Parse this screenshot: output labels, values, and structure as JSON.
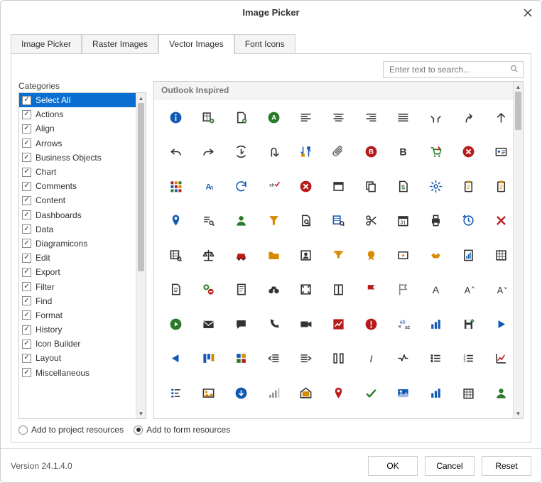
{
  "window": {
    "title": "Image Picker"
  },
  "tabs": [
    {
      "label": "Image Picker"
    },
    {
      "label": "Raster Images"
    },
    {
      "label": "Vector Images"
    },
    {
      "label": "Font Icons"
    }
  ],
  "active_tab": 2,
  "search": {
    "placeholder": "Enter text to search..."
  },
  "categories_label": "Categories",
  "categories": [
    "Select All",
    "Actions",
    "Align",
    "Arrows",
    "Business Objects",
    "Chart",
    "Comments",
    "Content",
    "Dashboards",
    "Data",
    "Diagramicons",
    "Edit",
    "Export",
    "Filter",
    "Find",
    "Format",
    "History",
    "Icon Builder",
    "Layout",
    "Miscellaneous"
  ],
  "selected_category_index": 0,
  "group_header": "Outlook Inspired",
  "icons": [
    {
      "n": "info-icon",
      "c": "#1259b3",
      "t": "circle-i"
    },
    {
      "n": "add-column-icon",
      "c": "#2a7a2a",
      "t": "table-plus"
    },
    {
      "n": "add-page-icon",
      "c": "#333",
      "t": "page-plus"
    },
    {
      "n": "letter-a-circle-icon",
      "c": "#2a7a2a",
      "t": "circle-a"
    },
    {
      "n": "align-left-icon",
      "c": "#333",
      "t": "align-left"
    },
    {
      "n": "align-center-icon",
      "c": "#333",
      "t": "align-center"
    },
    {
      "n": "align-right-icon",
      "c": "#333",
      "t": "align-right"
    },
    {
      "n": "align-justify-icon",
      "c": "#333",
      "t": "align-justify"
    },
    {
      "n": "merge-arrows-icon",
      "c": "#333",
      "t": "merge"
    },
    {
      "n": "redo-up-icon",
      "c": "#333",
      "t": "redo-up"
    },
    {
      "n": "arrow-up-icon",
      "c": "#333",
      "t": "arrow-up"
    },
    {
      "n": "undo-icon",
      "c": "#333",
      "t": "undo"
    },
    {
      "n": "redo-icon",
      "c": "#333",
      "t": "redo"
    },
    {
      "n": "reload-icon",
      "c": "#333",
      "t": "reload-down"
    },
    {
      "n": "u-turn-icon",
      "c": "#333",
      "t": "uturn"
    },
    {
      "n": "swap-icon",
      "c": "#1259b3",
      "t": "swap"
    },
    {
      "n": "attachment-icon",
      "c": "#666",
      "t": "clip"
    },
    {
      "n": "bold-circle-icon",
      "c": "#b71c1c",
      "t": "circle-b"
    },
    {
      "n": "bold-icon",
      "c": "#333",
      "t": "bold"
    },
    {
      "n": "cart-icon",
      "c": "#2a7a2a",
      "t": "cart"
    },
    {
      "n": "error-icon",
      "c": "#b71c1c",
      "t": "circle-x"
    },
    {
      "n": "id-card-icon",
      "c": "#1259b3",
      "t": "card"
    },
    {
      "n": "apps-icon",
      "c": "#b71c1c",
      "t": "grid3"
    },
    {
      "n": "font-aa-icon",
      "c": "#1259b3",
      "t": "aa"
    },
    {
      "n": "refresh-icon",
      "c": "#1259b3",
      "t": "refresh"
    },
    {
      "n": "spellcheck-icon",
      "c": "#333",
      "t": "abc-check"
    },
    {
      "n": "cancel-icon",
      "c": "#b71c1c",
      "t": "circle-x"
    },
    {
      "n": "window-icon",
      "c": "#333",
      "t": "window"
    },
    {
      "n": "copy-icon",
      "c": "#333",
      "t": "copy"
    },
    {
      "n": "money-page-icon",
      "c": "#2a7a2a",
      "t": "page-dollar"
    },
    {
      "n": "gear-icon",
      "c": "#1259b3",
      "t": "gear"
    },
    {
      "n": "task-list-icon",
      "c": "#d68a00",
      "t": "clipboard"
    },
    {
      "n": "clipboard-icon",
      "c": "#d68a00",
      "t": "clipboard"
    },
    {
      "n": "pin-icon",
      "c": "#1259b3",
      "t": "pin"
    },
    {
      "n": "search-list-icon",
      "c": "#333",
      "t": "list-search"
    },
    {
      "n": "user-icon",
      "c": "#2a7a2a",
      "t": "user"
    },
    {
      "n": "filter-icon",
      "c": "#d68a00",
      "t": "funnel"
    },
    {
      "n": "page-search-icon",
      "c": "#333",
      "t": "page-search"
    },
    {
      "n": "data-search-icon",
      "c": "#1259b3",
      "t": "data-search"
    },
    {
      "n": "cut-icon",
      "c": "#333",
      "t": "scissors"
    },
    {
      "n": "date-icon",
      "c": "#333",
      "t": "calendar"
    },
    {
      "n": "print-icon",
      "c": "#333",
      "t": "printer"
    },
    {
      "n": "history-icon",
      "c": "#1259b3",
      "t": "clock-arrow"
    },
    {
      "n": "close-red-icon",
      "c": "#b71c1c",
      "t": "x"
    },
    {
      "n": "table-search-icon",
      "c": "#333",
      "t": "table-search"
    },
    {
      "n": "balance-icon",
      "c": "#333",
      "t": "balance"
    },
    {
      "n": "car-icon",
      "c": "#b71c1c",
      "t": "car"
    },
    {
      "n": "folder-icon",
      "c": "#d68a00",
      "t": "folder"
    },
    {
      "n": "contact-icon",
      "c": "#333",
      "t": "contact"
    },
    {
      "n": "trophy-icon",
      "c": "#d68a00",
      "t": "trophy"
    },
    {
      "n": "badge-icon",
      "c": "#d68a00",
      "t": "badge"
    },
    {
      "n": "rate-icon",
      "c": "#333",
      "t": "rate"
    },
    {
      "n": "handshake-icon",
      "c": "#d68a00",
      "t": "handshake"
    },
    {
      "n": "report-icon",
      "c": "#1259b3",
      "t": "report"
    },
    {
      "n": "spreadsheet-icon",
      "c": "#333",
      "t": "spreadsheet"
    },
    {
      "n": "document-icon",
      "c": "#333",
      "t": "doc"
    },
    {
      "n": "add-remove-icon",
      "c": "#2a7a2a",
      "t": "plus-minus"
    },
    {
      "n": "notes-icon",
      "c": "#333",
      "t": "notes"
    },
    {
      "n": "binoculars-icon",
      "c": "#333",
      "t": "binoc"
    },
    {
      "n": "fullscreen-icon",
      "c": "#333",
      "t": "fullscreen"
    },
    {
      "n": "book-icon",
      "c": "#333",
      "t": "book"
    },
    {
      "n": "flag-red-icon",
      "c": "#b71c1c",
      "t": "flag"
    },
    {
      "n": "flag-outline-icon",
      "c": "#888",
      "t": "flag-o"
    },
    {
      "n": "font-a-icon",
      "c": "#333",
      "t": "A"
    },
    {
      "n": "font-grow-icon",
      "c": "#333",
      "t": "A-up"
    },
    {
      "n": "font-shrink-icon",
      "c": "#333",
      "t": "A-down"
    },
    {
      "n": "play-circle-icon",
      "c": "#2a7a2a",
      "t": "circle-play"
    },
    {
      "n": "mail-icon",
      "c": "#333",
      "t": "mail"
    },
    {
      "n": "chat-icon",
      "c": "#333",
      "t": "chat"
    },
    {
      "n": "phone-icon",
      "c": "#333",
      "t": "phone"
    },
    {
      "n": "video-icon",
      "c": "#333",
      "t": "video"
    },
    {
      "n": "chart-up-icon",
      "c": "#b71c1c",
      "t": "chart-up"
    },
    {
      "n": "alert-icon",
      "c": "#b71c1c",
      "t": "circle-bang"
    },
    {
      "n": "translate-icon",
      "c": "#1259b3",
      "t": "ab-arrow"
    },
    {
      "n": "bar-chart-icon",
      "c": "#1259b3",
      "t": "bars"
    },
    {
      "n": "save-icon",
      "c": "#333",
      "t": "save"
    },
    {
      "n": "play-icon",
      "c": "#1259b3",
      "t": "play"
    },
    {
      "n": "triangle-left-icon",
      "c": "#1259b3",
      "t": "tri-left"
    },
    {
      "n": "kanban-icon",
      "c": "#1259b3",
      "t": "kanban"
    },
    {
      "n": "grid4-icon",
      "c": "#1259b3",
      "t": "grid4"
    },
    {
      "n": "indent-left-icon",
      "c": "#333",
      "t": "indent-l"
    },
    {
      "n": "indent-right-icon",
      "c": "#333",
      "t": "indent-r"
    },
    {
      "n": "columns-icon",
      "c": "#333",
      "t": "columns"
    },
    {
      "n": "italic-icon",
      "c": "#333",
      "t": "italic"
    },
    {
      "n": "task-item-icon",
      "c": "#333",
      "t": "check-line"
    },
    {
      "n": "bullets-icon",
      "c": "#333",
      "t": "bullets"
    },
    {
      "n": "numbered-icon",
      "c": "#333",
      "t": "numbered"
    },
    {
      "n": "chart-line-icon",
      "c": "#b71c1c",
      "t": "chart-line"
    },
    {
      "n": "list-bars-icon",
      "c": "#1259b3",
      "t": "list-bars"
    },
    {
      "n": "image-icon",
      "c": "#d68a00",
      "t": "image"
    },
    {
      "n": "download-circle-icon",
      "c": "#1259b3",
      "t": "circle-down"
    },
    {
      "n": "signal-icon",
      "c": "#888",
      "t": "signal"
    },
    {
      "n": "mail-open-icon",
      "c": "#d68a00",
      "t": "mail-open"
    },
    {
      "n": "pin-red-icon",
      "c": "#b71c1c",
      "t": "pin"
    },
    {
      "n": "check-green-icon",
      "c": "#2a7a2a",
      "t": "check"
    },
    {
      "n": "picture-icon",
      "c": "#1259b3",
      "t": "picture"
    },
    {
      "n": "analytics-icon",
      "c": "#1259b3",
      "t": "bars"
    },
    {
      "n": "calendar-grid-icon",
      "c": "#333",
      "t": "cal-grid"
    },
    {
      "n": "user-green-icon",
      "c": "#2a7a2a",
      "t": "user"
    }
  ],
  "radios": {
    "project": "Add to project resources",
    "form": "Add to form resources",
    "selected": "form"
  },
  "footer": {
    "version": "Version 24.1.4.0",
    "ok": "OK",
    "cancel": "Cancel",
    "reset": "Reset"
  }
}
